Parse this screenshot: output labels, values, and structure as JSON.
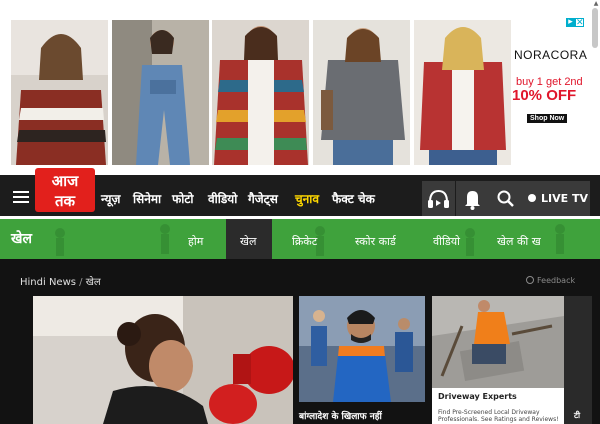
{
  "ad": {
    "close_icon": "close-icon",
    "info_icon": "adchoices-icon",
    "brand": "NORACORA",
    "promo": "buy 1 get 2nd",
    "discount": "10% OFF",
    "shop_label": "Shop Now"
  },
  "header": {
    "logo_text": "आज तक",
    "menu_icon": "hamburger-icon",
    "nav": [
      {
        "label": "न्यूज़"
      },
      {
        "label": "सिनेमा"
      },
      {
        "label": "फोटो"
      },
      {
        "label": "वीडियो"
      },
      {
        "label": "गैजेट्स"
      },
      {
        "label": "चुनाव"
      },
      {
        "label": "फैक्ट चेक"
      }
    ],
    "icons": [
      "podcast-icon",
      "bell-icon",
      "search-icon"
    ],
    "live_label": "LIVE TV"
  },
  "section": {
    "title": "खेल",
    "tabs": [
      {
        "label": "होम"
      },
      {
        "label": "खेल"
      },
      {
        "label": "क्रिकेट"
      },
      {
        "label": "स्कोर कार्ड"
      },
      {
        "label": "वीडियो"
      },
      {
        "label": "खेल की ख"
      }
    ],
    "active_tab": "खेल",
    "accent": "#3fa23c"
  },
  "breadcrumb": {
    "home": "Hindi News",
    "separator": "/",
    "current": "खेल"
  },
  "feedback_label": "Feedback",
  "cards": {
    "second_caption": "बांग्लादेश के खिलाफ नहीं",
    "ad_title": "Driveway Experts",
    "ad_text": "Find Pre-Screened Local Driveway Professionals. See Ratings and Reviews!",
    "side_caption": "टी"
  }
}
